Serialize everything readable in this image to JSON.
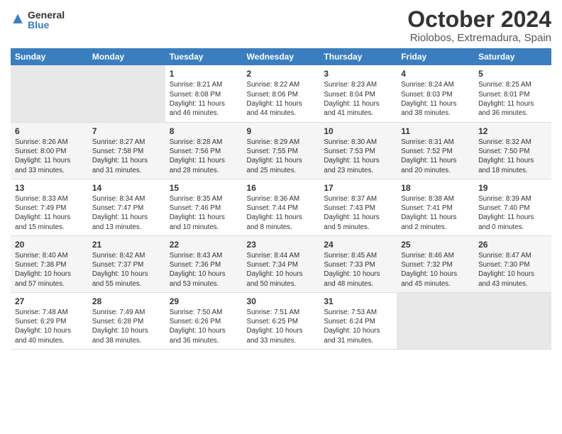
{
  "logo": {
    "general": "General",
    "blue": "Blue"
  },
  "title": "October 2024",
  "location": "Riolobos, Extremadura, Spain",
  "headers": [
    "Sunday",
    "Monday",
    "Tuesday",
    "Wednesday",
    "Thursday",
    "Friday",
    "Saturday"
  ],
  "weeks": [
    [
      {
        "day": "",
        "info": ""
      },
      {
        "day": "",
        "info": ""
      },
      {
        "day": "1",
        "info": "Sunrise: 8:21 AM\nSunset: 8:08 PM\nDaylight: 11 hours and 46 minutes."
      },
      {
        "day": "2",
        "info": "Sunrise: 8:22 AM\nSunset: 8:06 PM\nDaylight: 11 hours and 44 minutes."
      },
      {
        "day": "3",
        "info": "Sunrise: 8:23 AM\nSunset: 8:04 PM\nDaylight: 11 hours and 41 minutes."
      },
      {
        "day": "4",
        "info": "Sunrise: 8:24 AM\nSunset: 8:03 PM\nDaylight: 11 hours and 38 minutes."
      },
      {
        "day": "5",
        "info": "Sunrise: 8:25 AM\nSunset: 8:01 PM\nDaylight: 11 hours and 36 minutes."
      }
    ],
    [
      {
        "day": "6",
        "info": "Sunrise: 8:26 AM\nSunset: 8:00 PM\nDaylight: 11 hours and 33 minutes."
      },
      {
        "day": "7",
        "info": "Sunrise: 8:27 AM\nSunset: 7:58 PM\nDaylight: 11 hours and 31 minutes."
      },
      {
        "day": "8",
        "info": "Sunrise: 8:28 AM\nSunset: 7:56 PM\nDaylight: 11 hours and 28 minutes."
      },
      {
        "day": "9",
        "info": "Sunrise: 8:29 AM\nSunset: 7:55 PM\nDaylight: 11 hours and 25 minutes."
      },
      {
        "day": "10",
        "info": "Sunrise: 8:30 AM\nSunset: 7:53 PM\nDaylight: 11 hours and 23 minutes."
      },
      {
        "day": "11",
        "info": "Sunrise: 8:31 AM\nSunset: 7:52 PM\nDaylight: 11 hours and 20 minutes."
      },
      {
        "day": "12",
        "info": "Sunrise: 8:32 AM\nSunset: 7:50 PM\nDaylight: 11 hours and 18 minutes."
      }
    ],
    [
      {
        "day": "13",
        "info": "Sunrise: 8:33 AM\nSunset: 7:49 PM\nDaylight: 11 hours and 15 minutes."
      },
      {
        "day": "14",
        "info": "Sunrise: 8:34 AM\nSunset: 7:47 PM\nDaylight: 11 hours and 13 minutes."
      },
      {
        "day": "15",
        "info": "Sunrise: 8:35 AM\nSunset: 7:46 PM\nDaylight: 11 hours and 10 minutes."
      },
      {
        "day": "16",
        "info": "Sunrise: 8:36 AM\nSunset: 7:44 PM\nDaylight: 11 hours and 8 minutes."
      },
      {
        "day": "17",
        "info": "Sunrise: 8:37 AM\nSunset: 7:43 PM\nDaylight: 11 hours and 5 minutes."
      },
      {
        "day": "18",
        "info": "Sunrise: 8:38 AM\nSunset: 7:41 PM\nDaylight: 11 hours and 2 minutes."
      },
      {
        "day": "19",
        "info": "Sunrise: 8:39 AM\nSunset: 7:40 PM\nDaylight: 11 hours and 0 minutes."
      }
    ],
    [
      {
        "day": "20",
        "info": "Sunrise: 8:40 AM\nSunset: 7:38 PM\nDaylight: 10 hours and 57 minutes."
      },
      {
        "day": "21",
        "info": "Sunrise: 8:42 AM\nSunset: 7:37 PM\nDaylight: 10 hours and 55 minutes."
      },
      {
        "day": "22",
        "info": "Sunrise: 8:43 AM\nSunset: 7:36 PM\nDaylight: 10 hours and 53 minutes."
      },
      {
        "day": "23",
        "info": "Sunrise: 8:44 AM\nSunset: 7:34 PM\nDaylight: 10 hours and 50 minutes."
      },
      {
        "day": "24",
        "info": "Sunrise: 8:45 AM\nSunset: 7:33 PM\nDaylight: 10 hours and 48 minutes."
      },
      {
        "day": "25",
        "info": "Sunrise: 8:46 AM\nSunset: 7:32 PM\nDaylight: 10 hours and 45 minutes."
      },
      {
        "day": "26",
        "info": "Sunrise: 8:47 AM\nSunset: 7:30 PM\nDaylight: 10 hours and 43 minutes."
      }
    ],
    [
      {
        "day": "27",
        "info": "Sunrise: 7:48 AM\nSunset: 6:29 PM\nDaylight: 10 hours and 40 minutes."
      },
      {
        "day": "28",
        "info": "Sunrise: 7:49 AM\nSunset: 6:28 PM\nDaylight: 10 hours and 38 minutes."
      },
      {
        "day": "29",
        "info": "Sunrise: 7:50 AM\nSunset: 6:26 PM\nDaylight: 10 hours and 36 minutes."
      },
      {
        "day": "30",
        "info": "Sunrise: 7:51 AM\nSunset: 6:25 PM\nDaylight: 10 hours and 33 minutes."
      },
      {
        "day": "31",
        "info": "Sunrise: 7:53 AM\nSunset: 6:24 PM\nDaylight: 10 hours and 31 minutes."
      },
      {
        "day": "",
        "info": ""
      },
      {
        "day": "",
        "info": ""
      }
    ]
  ]
}
